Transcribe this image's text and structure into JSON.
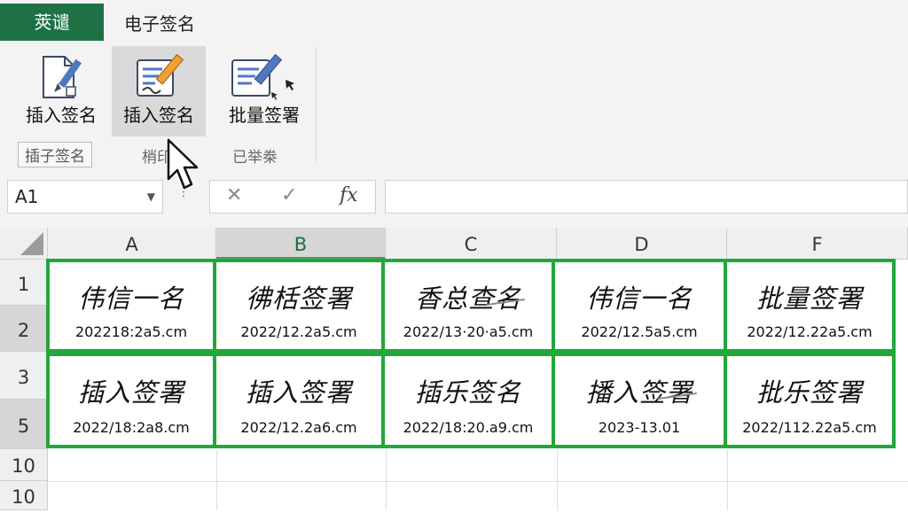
{
  "tabs": {
    "file_label": "莢谴",
    "esign_label": "电子签名"
  },
  "ribbon": {
    "buttons": [
      {
        "label": "插入签名",
        "icon": "document-pen-icon"
      },
      {
        "label": "插入签名",
        "icon": "form-pencil-icon"
      },
      {
        "label": "批量签署",
        "icon": "batch-sign-icon"
      }
    ],
    "groups": [
      "插子签名",
      "梢印",
      "已举桊"
    ]
  },
  "formula_bar": {
    "name_box": "A1",
    "cancel_icon": "✕",
    "confirm_icon": "✓",
    "fx_icon": "fx",
    "formula": ""
  },
  "grid": {
    "columns": [
      "A",
      "B",
      "C",
      "D",
      "F"
    ],
    "selected_column": "B",
    "rows": [
      "1",
      "2",
      "3",
      "5",
      "10",
      "10"
    ],
    "signatures": [
      {
        "col": "A",
        "sig": "伟信一名",
        "date": "202218:2a5.cm"
      },
      {
        "col": "B",
        "sig": "彿栝签署",
        "date": "2022/12.2a5.cm"
      },
      {
        "col": "C",
        "sig": "香总查名",
        "date": "2022/13·20·a5.cm"
      },
      {
        "col": "D",
        "sig": "伟信一名",
        "date": "2022/12.5a5.cm"
      },
      {
        "col": "F",
        "sig": "批量签署",
        "date": "2022/12.22a5.cm"
      },
      {
        "col": "A",
        "sig": "插入签署",
        "date": "2022/18:2a8.cm"
      },
      {
        "col": "B",
        "sig": "插入签署",
        "date": "2022/12.2a6.cm"
      },
      {
        "col": "C",
        "sig": "插乐签名",
        "date": "2022/18:20.a9.cm"
      },
      {
        "col": "D",
        "sig": "播入签署",
        "date": "2023-13.01"
      },
      {
        "col": "F",
        "sig": "批乐签署",
        "date": "2022/112.22a5.cm"
      }
    ]
  },
  "colors": {
    "file_tab": "#1e7145",
    "signature_border": "#22a83a",
    "ribbon_bg": "#f3f3f3"
  }
}
